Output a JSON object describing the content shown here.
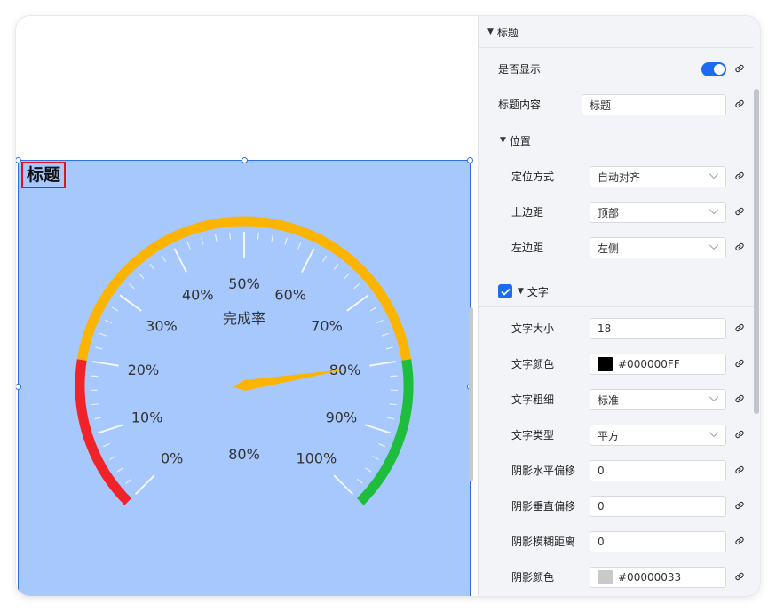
{
  "widget": {
    "title": "标题",
    "gauge": {
      "center_label": "完成率",
      "value_label": "80%",
      "value_fraction": 0.8,
      "tick_labels": [
        "0%",
        "10%",
        "20%",
        "30%",
        "40%",
        "50%",
        "60%",
        "70%",
        "80%",
        "90%",
        "100%"
      ],
      "bands": [
        {
          "from": 0,
          "to": 0.2,
          "color": "#f02428"
        },
        {
          "from": 0.2,
          "to": 0.8,
          "color": "#fbb400"
        },
        {
          "from": 0.8,
          "to": 1.0,
          "color": "#1fbd3c"
        }
      ],
      "pointer_color": "#fbb400"
    }
  },
  "panel": {
    "title_section": "标题",
    "show_label": "是否显示",
    "show_value": true,
    "title_content_label": "标题内容",
    "title_content_value": "标题",
    "position_section": "位置",
    "position_mode_label": "定位方式",
    "position_mode_value": "自动对齐",
    "top_margin_label": "上边距",
    "top_margin_value": "顶部",
    "left_margin_label": "左边距",
    "left_margin_value": "左侧",
    "text_section": "文字",
    "text_enabled": true,
    "font_size_label": "文字大小",
    "font_size_value": "18",
    "font_color_label": "文字颜色",
    "font_color_value": "#000000FF",
    "font_color_swatch": "#000000",
    "font_weight_label": "文字粗细",
    "font_weight_value": "标准",
    "font_type_label": "文字类型",
    "font_type_value": "平方",
    "shadow_x_label": "阴影水平偏移",
    "shadow_x_value": "0",
    "shadow_y_label": "阴影垂直偏移",
    "shadow_y_value": "0",
    "shadow_blur_label": "阴影模糊距离",
    "shadow_blur_value": "0",
    "shadow_color_label": "阴影颜色",
    "shadow_color_value": "#00000033",
    "shadow_color_swatch": "#c9c9c9"
  }
}
